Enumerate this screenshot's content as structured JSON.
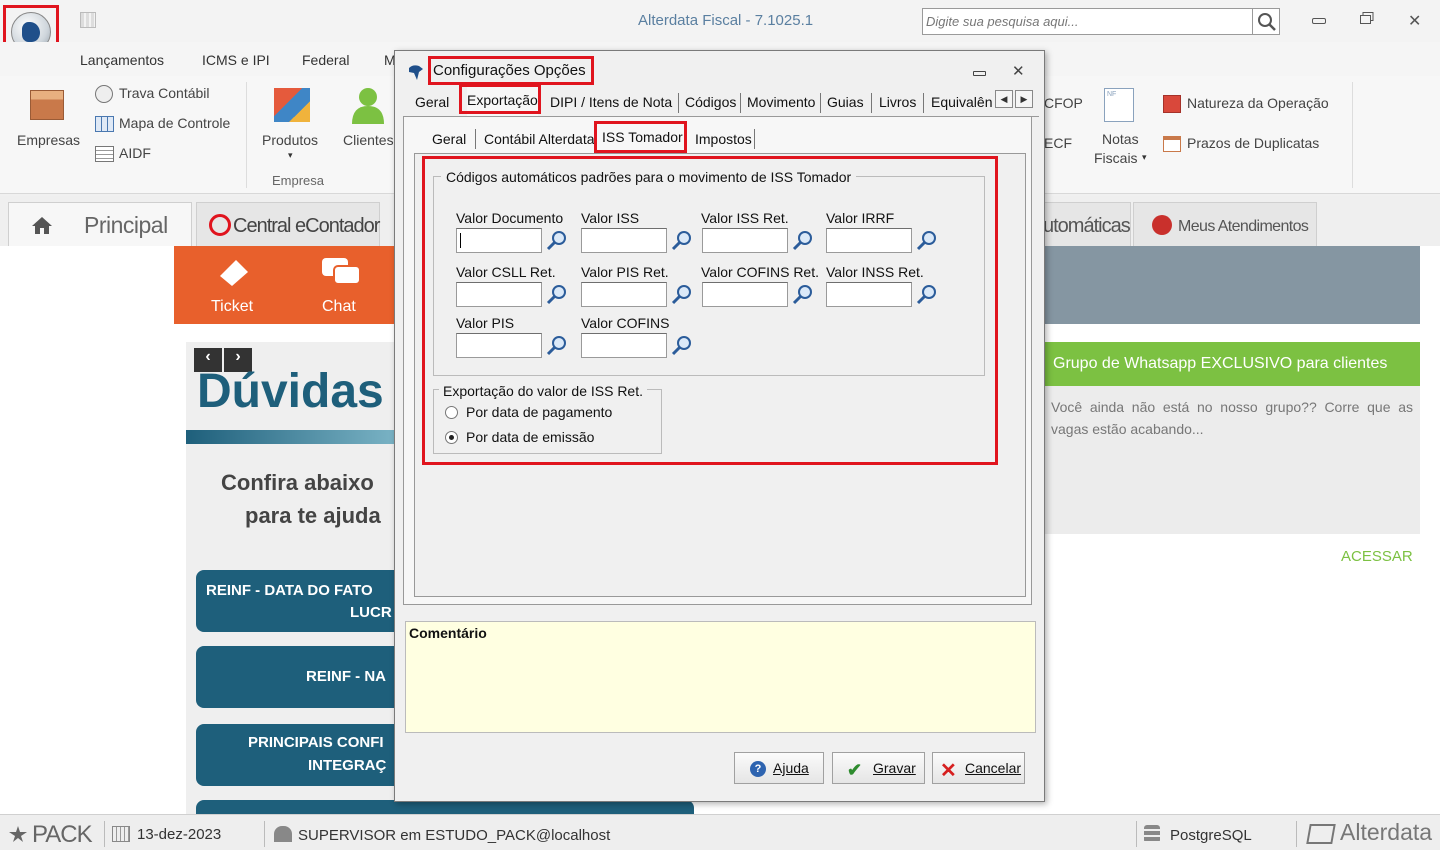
{
  "app": {
    "title": "Alterdata Fiscal - 7.1025.1",
    "search_placeholder": "Digite sua pesquisa aqui..."
  },
  "menu": {
    "items": [
      "Lançamentos",
      "ICMS e IPI",
      "Federal",
      "M"
    ]
  },
  "ribbon": {
    "empresas": "Empresas",
    "trava": "Trava Contábil",
    "mapa": "Mapa de Controle",
    "aidf": "AIDF",
    "produtos": "Produtos",
    "clientes": "Clientes",
    "group_empresa": "Empresa",
    "cfop": "CFOP",
    "ecf": "ECF",
    "notas_line1": "Notas",
    "notas_line2": "Fiscais",
    "natureza": "Natureza da Operação",
    "prazos": "Prazos de Duplicatas"
  },
  "pagetabs": {
    "principal": "Principal",
    "central": "Central eContador",
    "automaticas": "utomáticas",
    "meus": "Meus Atendimentos"
  },
  "home": {
    "ticket": "Ticket",
    "chat": "Chat",
    "duvidas": "Dúvidas",
    "confira1": "Confira abaixo",
    "confira2": "para te ajuda",
    "card1a": "REINF - DATA DO FATO",
    "card1b": "LUCR",
    "card2": "REINF - NA",
    "card3a": "PRINCIPAIS CONFI",
    "card3b": "INTEGRAÇ",
    "whatsapp_title": "Grupo de Whatsapp EXCLUSIVO para clientes",
    "whatsapp_text": "Você ainda não está no nosso grupo?? Corre que as vagas estão acabando...",
    "acessar": "ACESSAR",
    "colors": {
      "orange": "#e8602c",
      "teal": "#1e5f7b",
      "green": "#7cc142"
    }
  },
  "status": {
    "pack": "PACK",
    "date": "13-dez-2023",
    "user": "SUPERVISOR em ESTUDO_PACK@localhost",
    "db": "PostgreSQL",
    "brand": "Alterdata"
  },
  "dialog": {
    "title": "Configurações Opções",
    "tabs": [
      "Geral",
      "Exportação",
      "DIPI / Itens de Nota",
      "Códigos",
      "Movimento",
      "Guias",
      "Livros",
      "Equivalên"
    ],
    "subtabs": [
      "Geral",
      "Contábil Alterdata",
      "ISS Tomador",
      "Impostos"
    ],
    "group1_title": "Códigos automáticos padrões para o movimento de ISS Tomador",
    "fields": [
      {
        "label": "Valor Documento",
        "value": ""
      },
      {
        "label": "Valor ISS",
        "value": ""
      },
      {
        "label": "Valor ISS Ret.",
        "value": ""
      },
      {
        "label": "Valor IRRF",
        "value": ""
      },
      {
        "label": "Valor CSLL Ret.",
        "value": ""
      },
      {
        "label": "Valor PIS Ret.",
        "value": ""
      },
      {
        "label": "Valor COFINS Ret.",
        "value": ""
      },
      {
        "label": "Valor INSS Ret.",
        "value": ""
      },
      {
        "label": "Valor PIS",
        "value": ""
      },
      {
        "label": "Valor COFINS",
        "value": ""
      }
    ],
    "group2_title": "Exportação do valor de ISS Ret.",
    "radios": [
      {
        "label": "Por data de pagamento",
        "checked": false
      },
      {
        "label": "Por data de emissão",
        "checked": true
      }
    ],
    "comment_label": "Comentário",
    "buttons": {
      "ajuda": "Ajuda",
      "gravar": "Gravar",
      "cancelar": "Cancelar"
    }
  }
}
